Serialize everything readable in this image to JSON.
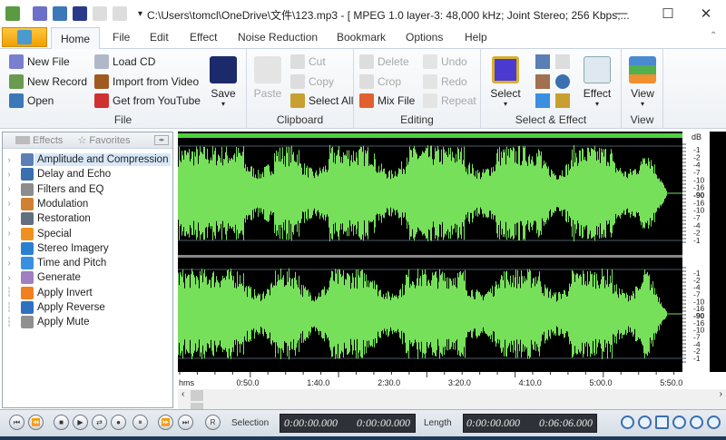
{
  "window": {
    "title": "C:\\Users\\tomcl\\OneDrive\\文件\\123.mp3 - [ MPEG 1.0 layer-3: 48,000 kHz; Joint Stereo; 256 Kbps;...",
    "minimize": "—",
    "maximize": "☐",
    "close": "✕"
  },
  "tabs": [
    "Home",
    "File",
    "Edit",
    "Effect",
    "Noise Reduction",
    "Bookmark",
    "Options",
    "Help"
  ],
  "ribbon": {
    "file": {
      "label": "File",
      "new_file": "New File",
      "new_record": "New Record",
      "open": "Open",
      "load_cd": "Load CD",
      "import_video": "Import from Video",
      "youtube": "Get from YouTube",
      "save": "Save"
    },
    "clipboard": {
      "label": "Clipboard",
      "paste": "Paste",
      "cut": "Cut",
      "copy": "Copy",
      "select_all": "Select All"
    },
    "editing": {
      "label": "Editing",
      "delete": "Delete",
      "crop": "Crop",
      "mix_file": "Mix File",
      "undo": "Undo",
      "redo": "Redo",
      "repeat": "Repeat"
    },
    "select_effect": {
      "label": "Select & Effect",
      "select": "Select",
      "effect": "Effect"
    },
    "view": {
      "label": "View",
      "view": "View"
    }
  },
  "left_panel": {
    "tab_effects": "Effects",
    "tab_favorites": "Favorites",
    "items": [
      {
        "label": "Amplitude and Compression",
        "expandable": true,
        "selected": true,
        "color": "#5b7fb5"
      },
      {
        "label": "Delay and Echo",
        "expandable": true,
        "color": "#3a6fb0"
      },
      {
        "label": "Filters and EQ",
        "expandable": true,
        "color": "#8c8c8c"
      },
      {
        "label": "Modulation",
        "expandable": true,
        "color": "#d08030"
      },
      {
        "label": "Restoration",
        "expandable": true,
        "color": "#607080"
      },
      {
        "label": "Special",
        "expandable": true,
        "color": "#f09020"
      },
      {
        "label": "Stereo Imagery",
        "expandable": true,
        "color": "#2a80d0"
      },
      {
        "label": "Time and Pitch",
        "expandable": true,
        "color": "#3a90e0"
      },
      {
        "label": "Generate",
        "expandable": true,
        "color": "#a080c0"
      },
      {
        "label": "Apply Invert",
        "expandable": false,
        "color": "#f08020"
      },
      {
        "label": "Apply Reverse",
        "expandable": false,
        "color": "#3070c0"
      },
      {
        "label": "Apply Mute",
        "expandable": false,
        "color": "#909090"
      }
    ]
  },
  "waveform": {
    "color": "#77e05a",
    "db_unit": "dB",
    "db_labels": [
      "-1",
      "-2",
      "-4",
      "-7",
      "-10",
      "-16",
      "-90",
      "-16",
      "-10",
      "-7",
      "-4",
      "-2",
      "-1"
    ],
    "time_unit": "hms",
    "time_labels": [
      "0:50.0",
      "1:40.0",
      "2:30.0",
      "3:20.0",
      "4:10.0",
      "5:00.0",
      "5:50.0"
    ]
  },
  "transport": {
    "buttons": [
      "⏮",
      "⏪",
      "■",
      "▶",
      "⇄",
      "●",
      "⏸",
      "⏩",
      "⏭"
    ],
    "r_label": "R",
    "selection_label": "Selection",
    "selection_start": "0:00:00.000",
    "selection_end": "0:00:00.000",
    "length_label": "Length",
    "length_start": "0:00:00.000",
    "length_end": "0:06:06.000"
  }
}
